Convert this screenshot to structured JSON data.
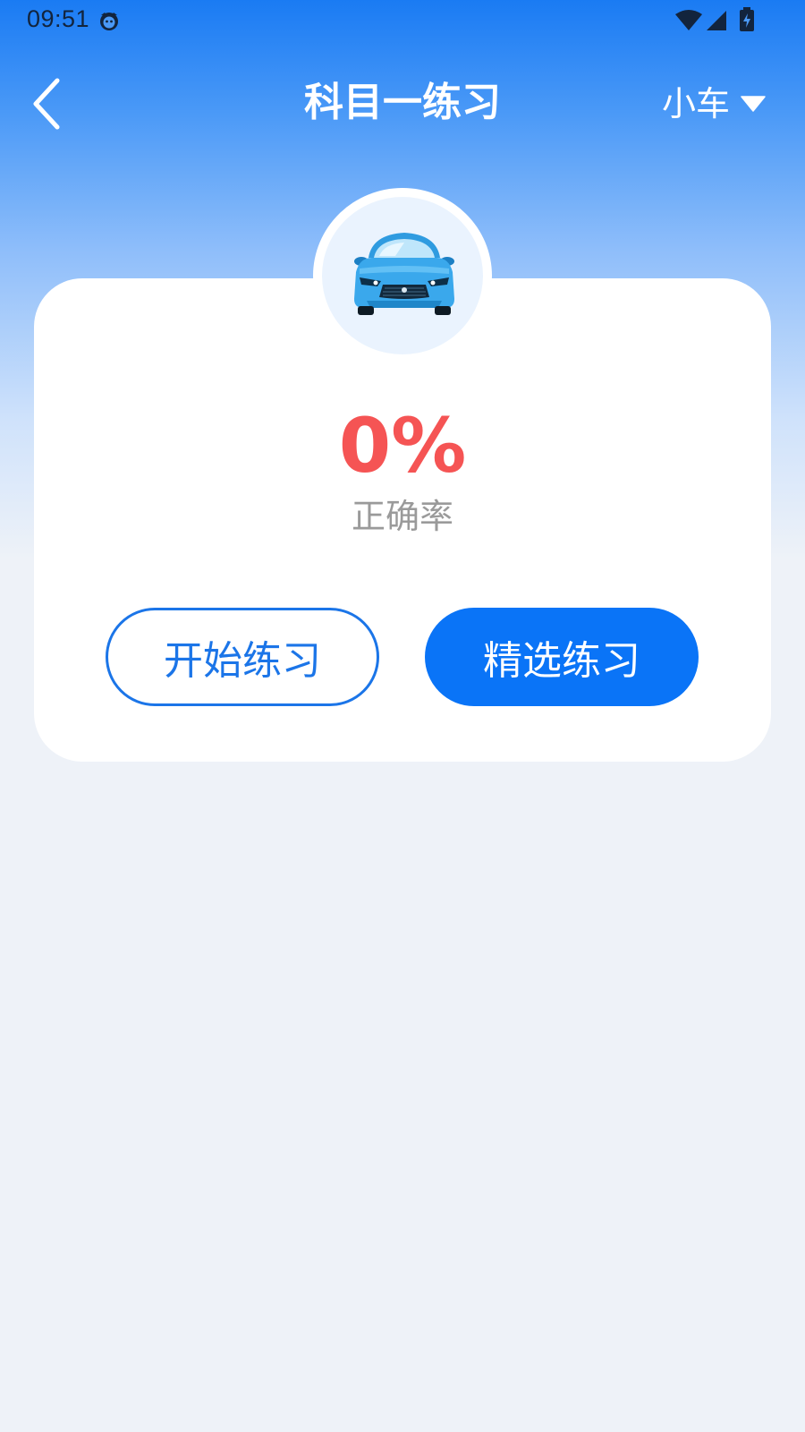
{
  "status_bar": {
    "time": "09:51",
    "notification_icon": "cat-face-icon",
    "wifi_icon": "wifi-icon",
    "signal_icon": "cell-signal-icon",
    "battery_icon": "battery-charging-icon"
  },
  "nav": {
    "back_icon": "chevron-left-icon",
    "title": "科目一练习",
    "vehicle_type": "小车",
    "caret_icon": "caret-down-icon"
  },
  "card": {
    "avatar_icon": "car-icon",
    "accuracy_value": "0%",
    "accuracy_label": "正确率",
    "start_button": "开始练习",
    "select_button": "精选练习"
  },
  "colors": {
    "primary": "#0a74f7",
    "accent_red": "#f55454",
    "background": "#eef2f8"
  }
}
